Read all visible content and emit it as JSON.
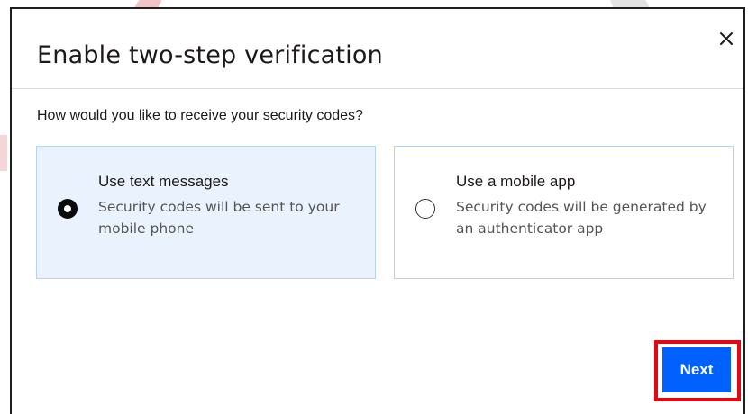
{
  "dialog": {
    "title": "Enable two-step verification",
    "question": "How would you like to receive your security codes?",
    "close_icon": "close-icon",
    "options": [
      {
        "title": "Use text messages",
        "description": "Security codes will be sent to your mobile phone",
        "selected": true
      },
      {
        "title": "Use a mobile app",
        "description": "Security codes will be generated by an authenticator app",
        "selected": false
      }
    ],
    "next_label": "Next"
  },
  "colors": {
    "primary_button": "#0061fe",
    "selected_option_bg": "#e9f2fd",
    "option_border": "#b7d3ee",
    "highlight_box": "#e30613"
  }
}
